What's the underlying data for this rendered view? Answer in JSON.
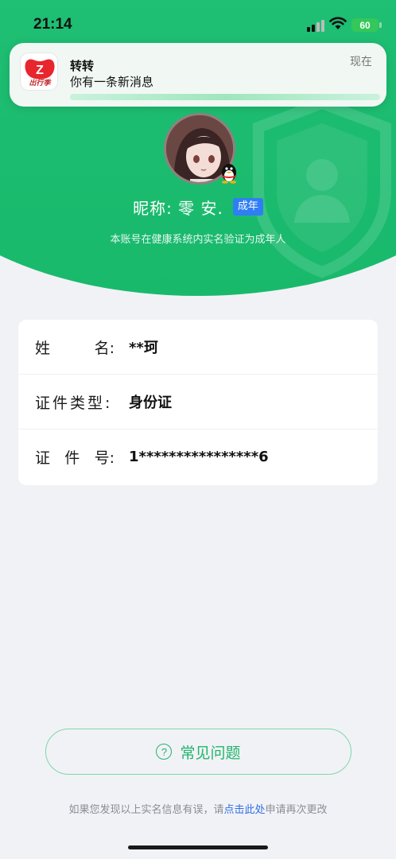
{
  "status_bar": {
    "time": "21:14",
    "battery": "60"
  },
  "notification": {
    "app_name": "转转",
    "message": "你有一条新消息",
    "time": "现在",
    "icon_caption": "出行季"
  },
  "profile": {
    "nickname": "昵称: 零 安.",
    "age_badge": "成年",
    "verify_note": "本账号在健康系统内实名验证为成年人"
  },
  "info": {
    "rows": [
      {
        "label_chars": [
          "姓",
          "名:"
        ],
        "value": "**珂"
      },
      {
        "label_chars": [
          "证件类型:"
        ],
        "value": "身份证"
      },
      {
        "label_chars": [
          "证",
          "件",
          "号:"
        ],
        "value": "1****************6"
      }
    ]
  },
  "faq": {
    "label": "常见问题",
    "icon": "?"
  },
  "footer": {
    "prefix": "如果您发现以上实名信息有误，请",
    "link": "点击此处",
    "suffix": "申请再次更改"
  },
  "colors": {
    "brand_green": "#21c47a",
    "badge_blue": "#2f7ef5",
    "link_blue": "#2f6fe6"
  }
}
